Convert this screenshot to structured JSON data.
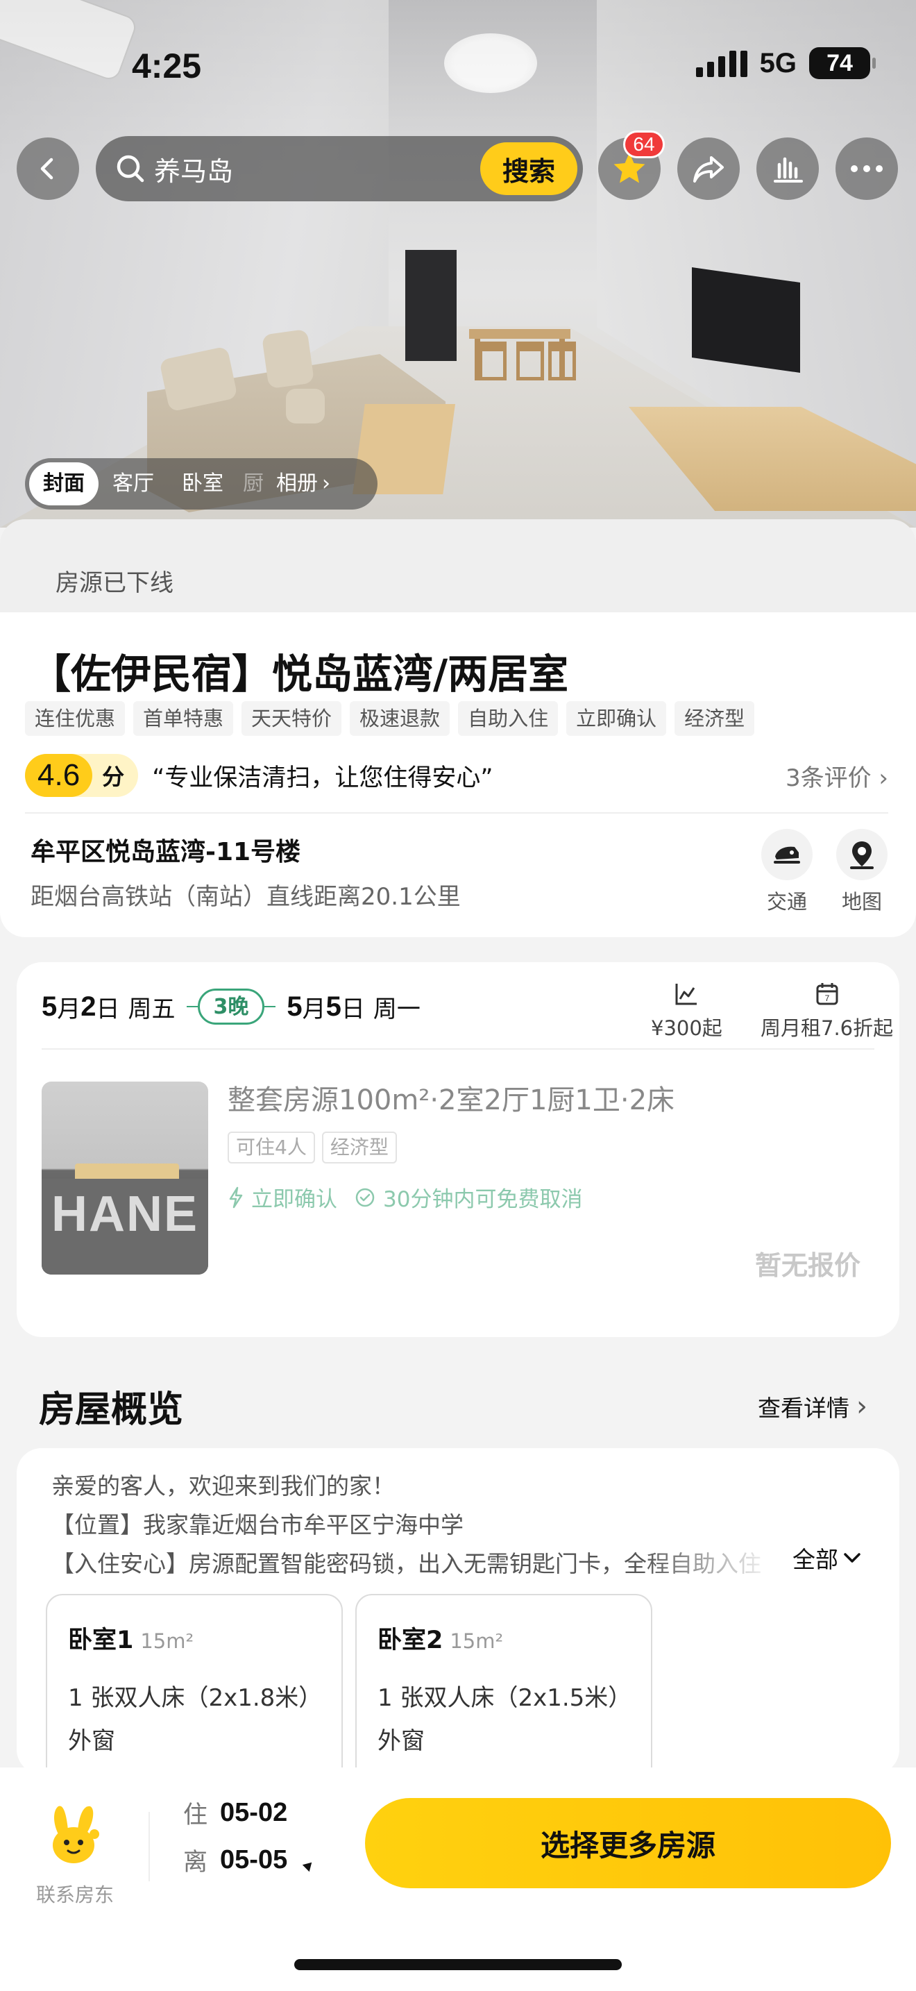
{
  "status_bar": {
    "time": "4:25",
    "network": "5G",
    "battery": "74"
  },
  "nav": {
    "search_text": "养马岛",
    "search_button": "搜索",
    "favorite_badge": "64",
    "icons": [
      "back-icon",
      "search-icon",
      "star-icon",
      "share-icon",
      "chart-icon",
      "more-icon"
    ]
  },
  "photo_tabs": {
    "items": [
      "封面",
      "客厅",
      "卧室",
      "厨"
    ],
    "album": "相册",
    "active": "封面"
  },
  "notice": "房源已下线",
  "listing": {
    "title": "【佐伊民宿】悦岛蓝湾/两居室",
    "tags": [
      "连住优惠",
      "首单特惠",
      "天天特价",
      "极速退款",
      "自助入住",
      "立即确认",
      "经济型"
    ],
    "rating": "4.6",
    "rating_unit": "分",
    "quote": "“专业保洁清扫，让您住得安心”",
    "reviews": "3条评价",
    "address": "牟平区悦岛蓝湾-11号楼",
    "distance": "距烟台高铁站（南站）直线距离20.1公里",
    "transport_label": "交通",
    "map_label": "地图"
  },
  "booking": {
    "checkin": {
      "month": "5",
      "day": "2",
      "month_unit": "月",
      "day_unit": "日",
      "weekday": "周五"
    },
    "nights": "3晚",
    "checkout": {
      "month": "5",
      "day": "5",
      "month_unit": "月",
      "day_unit": "日",
      "weekday": "周一"
    },
    "price_from": "¥300起",
    "monthly": "周月租7.6折起",
    "room_title": "整套房源100m²·2室2厅1厨1卫·2床",
    "room_tags": [
      "可住4人",
      "经济型"
    ],
    "instant_confirm": "立即确认",
    "free_cancel": "30分钟内可免费取消",
    "no_price": "暂无报价",
    "thumb_logo": "HANE"
  },
  "overview": {
    "title": "房屋概览",
    "detail_link": "查看详情",
    "lines": [
      "亲爱的客人，欢迎来到我们的家！",
      "【位置】我家靠近烟台市牟平区宁海中学",
      "【入住安心】房源配置智能密码锁，出入无需钥匙门卡，全程自助入住"
    ],
    "expand": "全部",
    "bedrooms": [
      {
        "name": "卧室1",
        "area": "15m²",
        "bed": "1 张双人床（2x1.8米）",
        "window": "外窗"
      },
      {
        "name": "卧室2",
        "area": "15m²",
        "bed": "1 张双人床（2x1.5米）",
        "window": "外窗"
      }
    ]
  },
  "bottom_bar": {
    "contact_host": "联系房东",
    "checkin_label": "住",
    "checkin_date": "05-02",
    "checkout_label": "离",
    "checkout_date": "05-05",
    "cta": "选择更多房源"
  },
  "colors": {
    "accent_yellow": "#ffcc1a",
    "badge_red": "#f03a3a",
    "night_green": "#3aa57a",
    "confirm_green": "#8cc9ad"
  }
}
